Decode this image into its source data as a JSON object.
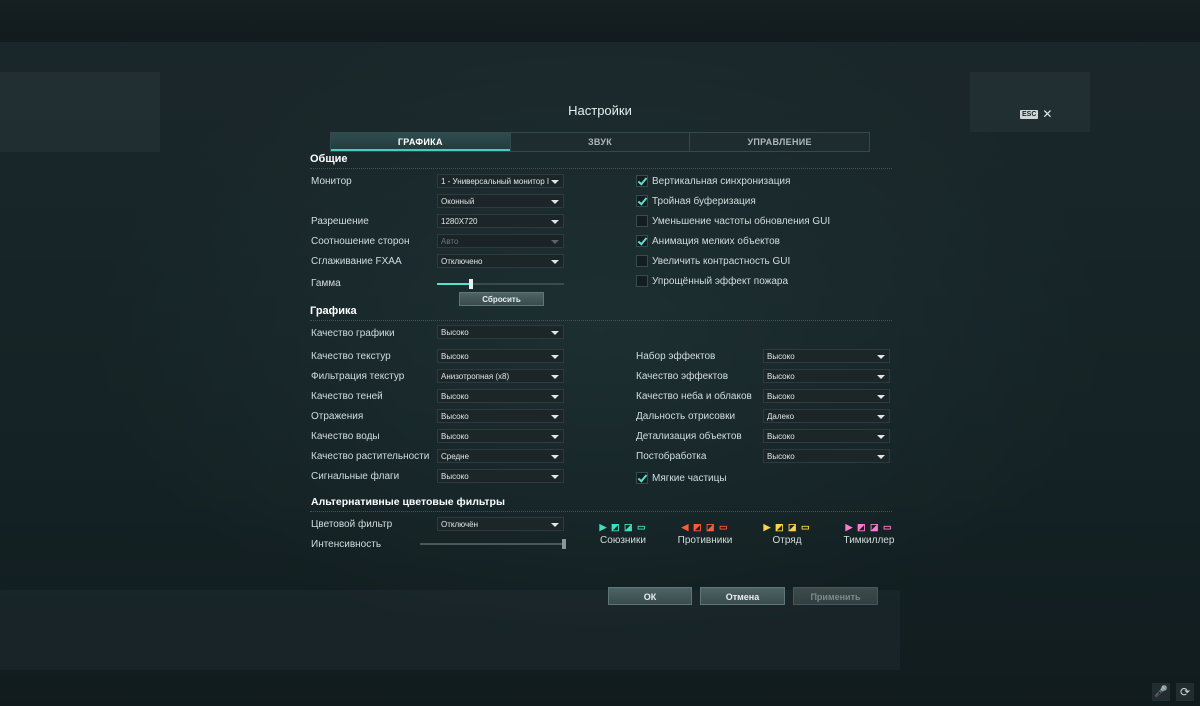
{
  "title": "Настройки",
  "esc": {
    "key": "ESC",
    "close": "✕"
  },
  "tabs": [
    "ГРАФИКА",
    "ЗВУК",
    "УПРАВЛЕНИЕ"
  ],
  "general": {
    "heading": "Общие",
    "monitor_label": "Монитор",
    "monitor_value": "1 - Универсальный монитор I",
    "window_mode_value": "Оконный",
    "resolution_label": "Разрешение",
    "resolution_value": "1280X720",
    "aspect_label": "Соотношение сторон",
    "aspect_value": "Авто",
    "fxaa_label": "Сглаживание FXAA",
    "fxaa_value": "Отключено",
    "gamma_label": "Гамма",
    "gamma_level": 0.27,
    "reset_label": "Сбросить",
    "checkboxes": [
      {
        "label": "Вертикальная синхронизация",
        "checked": true
      },
      {
        "label": "Тройная буферизация",
        "checked": true
      },
      {
        "label": "Уменьшение частоты обновления GUI",
        "checked": false
      },
      {
        "label": "Анимация мелких объектов",
        "checked": true
      },
      {
        "label": "Увеличить контрастность GUI",
        "checked": false
      },
      {
        "label": "Упрощённый эффект пожара",
        "checked": false
      }
    ]
  },
  "graphics": {
    "heading": "Графика",
    "quality_label": "Качество графики",
    "quality_value": "Высоко",
    "left": [
      {
        "label": "Качество текстур",
        "value": "Высоко"
      },
      {
        "label": "Фильтрация текстур",
        "value": "Анизотропная (x8)"
      },
      {
        "label": "Качество теней",
        "value": "Высоко"
      },
      {
        "label": "Отражения",
        "value": "Высоко"
      },
      {
        "label": "Качество воды",
        "value": "Высоко"
      },
      {
        "label": "Качество растительности",
        "value": "Средне"
      },
      {
        "label": "Сигнальные флаги",
        "value": "Высоко"
      }
    ],
    "right": [
      {
        "label": "Набор эффектов",
        "value": "Высоко"
      },
      {
        "label": "Качество эффектов",
        "value": "Высоко"
      },
      {
        "label": "Качество неба и облаков",
        "value": "Высоко"
      },
      {
        "label": "Дальность отрисовки",
        "value": "Далеко"
      },
      {
        "label": "Детализация объектов",
        "value": "Высоко"
      },
      {
        "label": "Постобработка",
        "value": "Высоко"
      }
    ],
    "soft_particles_label": "Мягкие частицы",
    "soft_particles_checked": true
  },
  "filters": {
    "heading": "Альтернативные цветовые фильтры",
    "filter_label": "Цветовой фильтр",
    "filter_value": "Отключён",
    "intensity_label": "Интенсивность",
    "intensity_level": 1.0,
    "groups": [
      {
        "name": "Союзники",
        "color": "#3fe0c0",
        "glyphs": "▶ ◩ ◪ ▭"
      },
      {
        "name": "Противники",
        "color": "#ff5a3a",
        "glyphs": "◀ ◩ ◪ ▭"
      },
      {
        "name": "Отряд",
        "color": "#ffd24a",
        "glyphs": "▶ ◩ ◪ ▭"
      },
      {
        "name": "Тимкиллер",
        "color": "#ff7ad0",
        "glyphs": "▶ ◩ ◪ ▭"
      }
    ]
  },
  "buttons": {
    "ok": "ОК",
    "cancel": "Отмена",
    "apply": "Применить"
  },
  "footer_icons": {
    "mic": "🎤",
    "sync": "⟳"
  }
}
